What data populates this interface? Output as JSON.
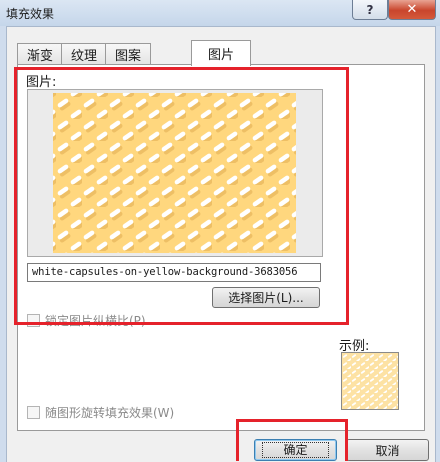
{
  "dialog": {
    "title": "填充效果"
  },
  "titlebar": {
    "help_label": "?",
    "close_label": "✕",
    "help_icon": "question-icon",
    "close_icon": "close-icon"
  },
  "tabs": [
    {
      "label": "渐变",
      "active": false
    },
    {
      "label": "纹理",
      "active": false
    },
    {
      "label": "图案",
      "active": false
    },
    {
      "label": "图片",
      "active": true
    }
  ],
  "picture": {
    "section_label": "图片:",
    "file_name": "white-capsules-on-yellow-background-3683056",
    "select_button": "选择图片(L)...",
    "background_color": "#ffd77e",
    "capsule_color": "#ffffff"
  },
  "options": {
    "lock_aspect": {
      "label": "锁定图片纵横比(P)",
      "checked": false,
      "enabled": false
    },
    "rotate_with_shape": {
      "label": "随图形旋转填充效果(W)",
      "checked": false,
      "enabled": false
    }
  },
  "sample": {
    "label": "示例:"
  },
  "footer": {
    "ok": "确定",
    "cancel": "取消"
  },
  "annotation_color": "#e5222b"
}
